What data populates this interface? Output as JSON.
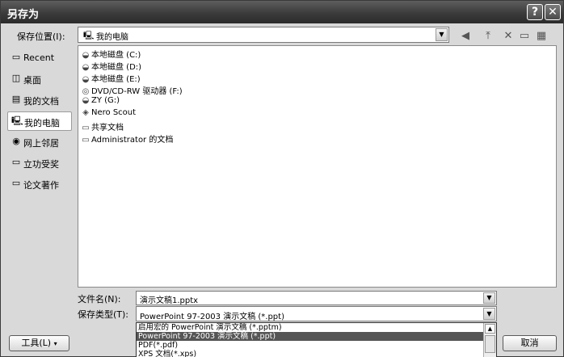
{
  "window": {
    "title": "另存为",
    "help_btn": "?",
    "close_btn": "✕"
  },
  "location": {
    "label": "保存位置(I):",
    "value": "我的电脑"
  },
  "toolbar": {
    "back": "◀",
    "up": "⤒",
    "delete": "✕",
    "newfolder": "▭",
    "views": "▦"
  },
  "places": [
    {
      "label": "Recent",
      "icon": "recent-folder-icon"
    },
    {
      "label": "桌面",
      "icon": "desktop-icon"
    },
    {
      "label": "我的文档",
      "icon": "documents-icon"
    },
    {
      "label": "我的电脑",
      "icon": "computer-icon"
    },
    {
      "label": "网上邻居",
      "icon": "network-icon"
    },
    {
      "label": "立功受奖",
      "icon": "folder-icon"
    },
    {
      "label": "论文著作",
      "icon": "folder-icon"
    }
  ],
  "files": [
    {
      "name": "本地磁盘 (C:)",
      "icon": "drive-icon"
    },
    {
      "name": "本地磁盘 (D:)",
      "icon": "drive-icon"
    },
    {
      "name": "本地磁盘 (E:)",
      "icon": "drive-icon"
    },
    {
      "name": "DVD/CD-RW 驱动器 (F:)",
      "icon": "cd-drive-icon"
    },
    {
      "name": "ZY (G:)",
      "icon": "drive-icon"
    },
    {
      "name": "Nero Scout",
      "icon": "nero-icon"
    },
    {
      "name": "共享文档",
      "icon": "folder-icon"
    },
    {
      "name": "Administrator 的文档",
      "icon": "folder-icon"
    }
  ],
  "filename": {
    "label": "文件名(N):",
    "value": "演示文稿1.pptx"
  },
  "filetype": {
    "label": "保存类型(T):",
    "value": "PowerPoint 97-2003 演示文稿 (*.ppt)",
    "options": [
      "启用宏的 PowerPoint 演示文稿 (*.pptm)",
      "PowerPoint 97-2003 演示文稿 (*.ppt)",
      "PDF(*.pdf)",
      "XPS 文档(*.xps)"
    ]
  },
  "buttons": {
    "tools": "工具(L)",
    "cancel": "取消"
  }
}
